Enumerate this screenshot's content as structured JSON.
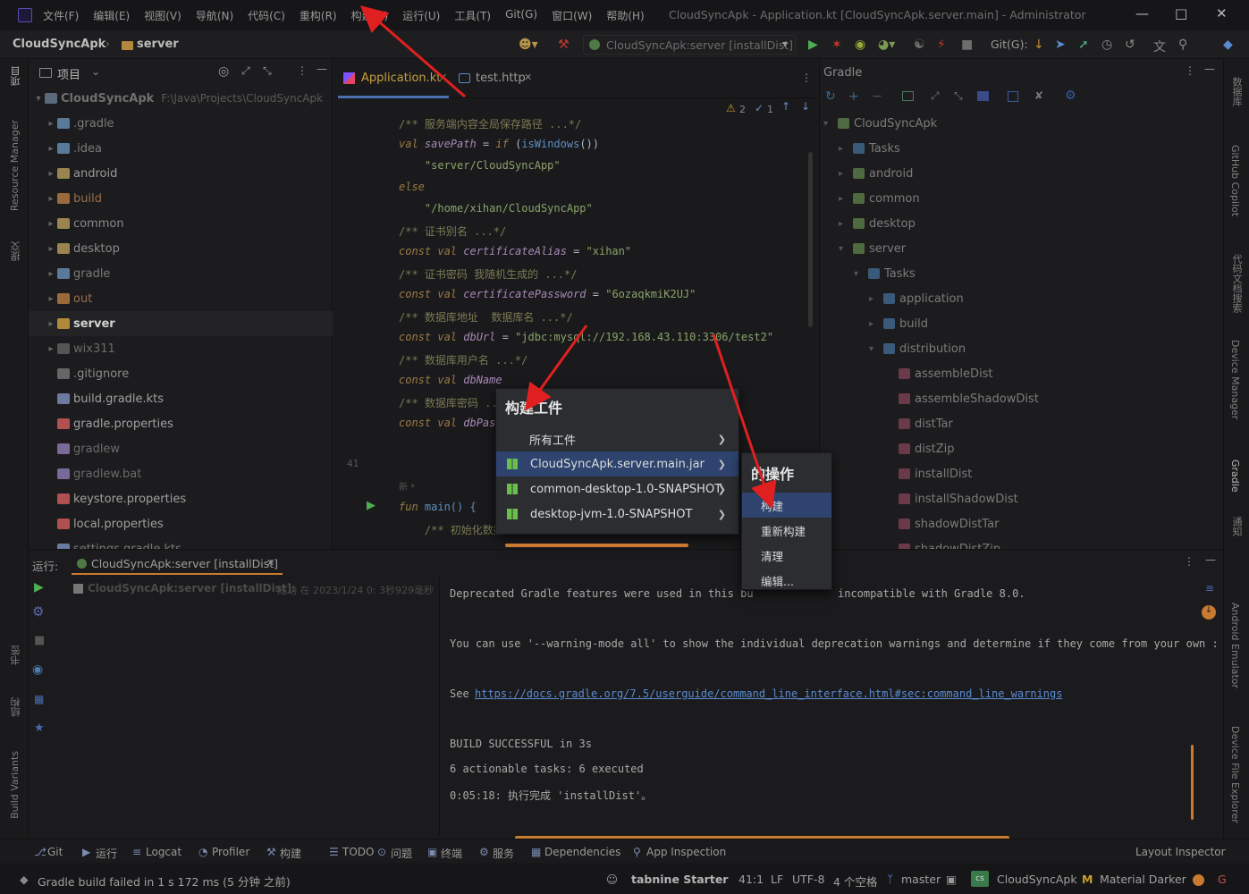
{
  "menubar": {
    "items": [
      "文件(F)",
      "编辑(E)",
      "视图(V)",
      "导航(N)",
      "代码(C)",
      "重构(R)",
      "构建(B)",
      "运行(U)",
      "工具(T)",
      "Git(G)",
      "窗口(W)",
      "帮助(H)"
    ],
    "window_title": "CloudSyncApk - Application.kt [CloudSyncApk.server.main] - Administrator"
  },
  "navbar": {
    "project": "CloudSyncApk",
    "module": "server",
    "run_config": "CloudSyncApk:server [installDist]",
    "git_label": "Git(G):"
  },
  "left_strip": {
    "labels": [
      "项目",
      "Resource Manager",
      "提交",
      "书签",
      "结构",
      "Build Variants"
    ]
  },
  "project_panel": {
    "title": "项目",
    "root": {
      "name": "CloudSyncApk",
      "path": "F:\\Java\\Projects\\CloudSyncApk"
    },
    "items": [
      {
        "name": ".gradle",
        "color": "#7a7a7a",
        "icon": "#5a7a9a"
      },
      {
        "name": ".idea",
        "color": "#7a7a7a",
        "icon": "#5a7a9a"
      },
      {
        "name": "android",
        "color": "#9a9a9a",
        "icon": "#9b8452"
      },
      {
        "name": "build",
        "color": "#9a6e50",
        "icon": "#9b6a3a"
      },
      {
        "name": "common",
        "color": "#8a8a8a",
        "icon": "#9b8452"
      },
      {
        "name": "desktop",
        "color": "#8a8a8a",
        "icon": "#9b8452"
      },
      {
        "name": "gradle",
        "color": "#7a7a7a",
        "icon": "#5a7a9a"
      },
      {
        "name": "out",
        "color": "#9a6e50",
        "icon": "#9b6a3a"
      },
      {
        "name": "server",
        "color": "#d2d2d2",
        "icon": "#b08a3a"
      },
      {
        "name": "wix311",
        "color": "#6a6a6a",
        "icon": "#555"
      },
      {
        "name": ".gitignore",
        "color": "#8a8a8a",
        "icon": "#666"
      },
      {
        "name": "build.gradle.kts",
        "color": "#a0a0a0",
        "icon": "#6a7aa0"
      },
      {
        "name": "gradle.properties",
        "color": "#a0a0a0",
        "icon": "#b05050"
      },
      {
        "name": "gradlew",
        "color": "#6a6a6a",
        "icon": "#7a6a9a"
      },
      {
        "name": "gradlew.bat",
        "color": "#6a6a6a",
        "icon": "#7a6a9a"
      },
      {
        "name": "keystore.properties",
        "color": "#a0a0a0",
        "icon": "#b05050"
      },
      {
        "name": "local.properties",
        "color": "#a0a0a0",
        "icon": "#b05050"
      },
      {
        "name": "settings.gradle.kts",
        "color": "#7a7a7a",
        "icon": "#6a7aa0"
      }
    ]
  },
  "editor": {
    "tabs": [
      {
        "label": "Application.kt",
        "active": true
      },
      {
        "label": "test.http",
        "active": false
      }
    ],
    "inspection": {
      "warnings": "2",
      "typos": "1"
    },
    "lines": [
      {
        "cmt": "/** 服务端内容全局保存路径 ...*/"
      },
      {
        "code": "val savePath = if (isWindows())"
      },
      {
        "str": "    \"server/CloudSyncApp\""
      },
      {
        "kw": "else"
      },
      {
        "str": "    \"/home/xihan/CloudSyncApp\""
      },
      {
        "cmt": "/** 证书别名 ...*/"
      },
      {
        "code": "const val certificateAlias = \"xihan\""
      },
      {
        "cmt": "/** 证书密码 我随机生成的 ...*/"
      },
      {
        "code": "const val certificatePassword = \"6ozaqkmiK2UJ\""
      },
      {
        "cmt": "/** 数据库地址  数据库名 ...*/"
      },
      {
        "code": "const val dbUrl = \"jdbc:mysql://192.168.43.110:3306/test2\""
      },
      {
        "cmt": "/** 数据库用户名 ...*/"
      },
      {
        "code": "const val dbName"
      },
      {
        "cmt": "/** 数据库密码 ..."
      },
      {
        "code": "const val dbPass"
      }
    ],
    "line_number": "41",
    "new_label": "新 *",
    "main_fun": "fun main() {",
    "main_comment": "    /** 初始化数据"
  },
  "gradle_panel": {
    "title": "Gradle",
    "items": [
      {
        "label": "CloudSyncApk",
        "indent": 0
      },
      {
        "label": "Tasks",
        "indent": 1
      },
      {
        "label": "android",
        "indent": 1
      },
      {
        "label": "common",
        "indent": 1
      },
      {
        "label": "desktop",
        "indent": 1
      },
      {
        "label": "server",
        "indent": 1
      },
      {
        "label": "Tasks",
        "indent": 2
      },
      {
        "label": "application",
        "indent": 3
      },
      {
        "label": "build",
        "indent": 3
      },
      {
        "label": "distribution",
        "indent": 3
      },
      {
        "label": "assembleDist",
        "indent": 4
      },
      {
        "label": "assembleShadowDist",
        "indent": 4
      },
      {
        "label": "distTar",
        "indent": 4
      },
      {
        "label": "distZip",
        "indent": 4
      },
      {
        "label": "installDist",
        "indent": 4
      },
      {
        "label": "installShadowDist",
        "indent": 4
      },
      {
        "label": "shadowDistTar",
        "indent": 4
      },
      {
        "label": "shadowDistZip",
        "indent": 4
      }
    ]
  },
  "right_strip": {
    "labels": [
      "数据库",
      "GitHub Copilot",
      "代码文档搜索",
      "Device Manager",
      "Gradle",
      "通知",
      "Android Emulator",
      "Device File Explorer"
    ]
  },
  "run_panel": {
    "label": "运行:",
    "tab": "CloudSyncApk:server [installDist]",
    "tree_item": "CloudSyncApk:server [installDist]:",
    "tree_status": "成功 在 2023/1/24 0: 3秒929毫秒",
    "console": [
      "Deprecated Gradle features were used in this bu",
      "incompatible with Gradle 8.0.",
      "You can use '--warning-mode all' to show the individual deprecation warnings and determine if they come from your own :",
      "See ",
      "https://docs.gradle.org/7.5/userguide/command_line_interface.html#sec:command_line_warnings",
      "BUILD SUCCESSFUL in 3s",
      "6 actionable tasks: 6 executed",
      "0:05:18: 执行完成 'installDist'。"
    ]
  },
  "popup_build": {
    "title": "构建工件",
    "items": [
      {
        "label": "所有工件",
        "icon": false,
        "selected": false
      },
      {
        "label": "CloudSyncApk.server.main.jar",
        "icon": true,
        "selected": true
      },
      {
        "label": "common-desktop-1.0-SNAPSHOT",
        "icon": true,
        "selected": false
      },
      {
        "label": "desktop-jvm-1.0-SNAPSHOT",
        "icon": true,
        "selected": false
      }
    ]
  },
  "popup_action": {
    "title": "的操作",
    "items": [
      {
        "label": "构建",
        "selected": true
      },
      {
        "label": "重新构建",
        "selected": false
      },
      {
        "label": "清理",
        "selected": false
      },
      {
        "label": "编辑...",
        "selected": false
      }
    ]
  },
  "tool_strip": {
    "items": [
      "Git",
      "运行",
      "Logcat",
      "Profiler",
      "构建",
      "TODO",
      "问题",
      "终端",
      "服务",
      "Dependencies",
      "App Inspection"
    ],
    "right": "Layout Inspector"
  },
  "status_bar": {
    "message": "Gradle build failed in 1 s 172 ms (5 分钟 之前)",
    "tabnine": "tabnine Starter",
    "position": "41:1",
    "line_sep": "LF",
    "encoding": "UTF-8",
    "indent": "4 个空格",
    "branch": "master",
    "project": "CloudSyncApk",
    "theme": "Material Darker"
  },
  "colors": {
    "accent_arrow": "#e02020",
    "selection": "#2e436e",
    "bg": "#1b1b1d"
  }
}
